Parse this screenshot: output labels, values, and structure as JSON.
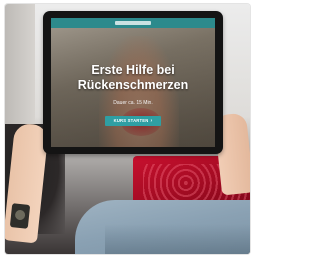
{
  "tablet_screen": {
    "title_line1": "Erste Hilfe bei",
    "title_line2": "Rückenschmerzen",
    "subtitle": "Dauer ca. 15 Min.",
    "cta_label": "KURS STARTEN",
    "cta_icon": "chevron-right-icon"
  },
  "colors": {
    "accent_teal": "#2f9fa3",
    "pillow_red": "#c8102e"
  }
}
